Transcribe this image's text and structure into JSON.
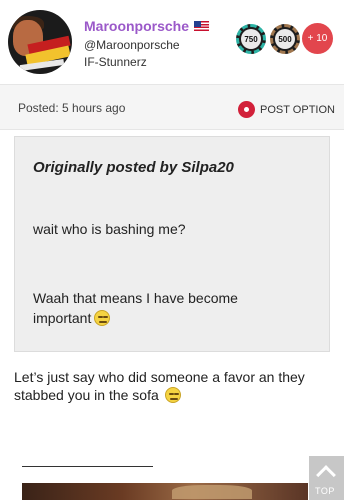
{
  "user": {
    "username": "Maroonporsche",
    "handle": "@Maroonporsche",
    "rank": "IF-Stunnerz",
    "flag_icon": "us-flag-icon"
  },
  "badges": [
    {
      "label": "750",
      "ring_color": "#2db3a5"
    },
    {
      "label": "500",
      "ring_color": "#a0774f"
    }
  ],
  "badge_more": "+ 10",
  "meta": {
    "posted": "Posted: 5 hours ago",
    "post_option": "POST OPTION",
    "gear_color": "#d2213a"
  },
  "quote": {
    "author_line": "Originally posted by Silpa20",
    "line1": "wait who is bashing me?",
    "line2": "Waah that means I have become",
    "line3": "important"
  },
  "reply": {
    "text": "Let’s just say who did someone a favor an they stabbed you in the sofa"
  },
  "scroll_top": {
    "label": "TOP"
  },
  "colors": {
    "username": "#9b59c9",
    "badge_more": "#e2464d"
  }
}
